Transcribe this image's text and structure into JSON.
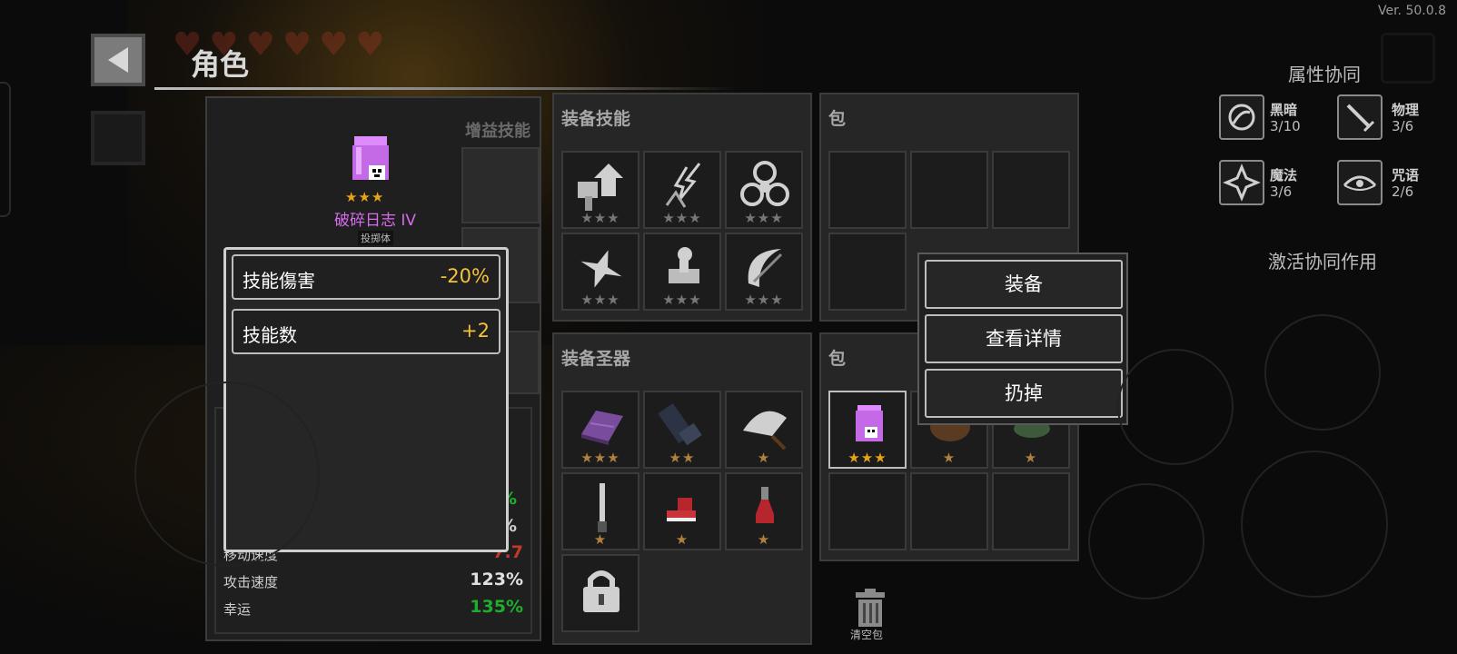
{
  "version": "Ver. 50.0.8",
  "header": {
    "title": "角色"
  },
  "character": {
    "name": "破碎日志 IV",
    "subtitle": "投掷体",
    "name_color": "#d86bf0"
  },
  "buff_skills": {
    "title": "增益技能"
  },
  "stats": [
    {
      "label": "移动速度",
      "value": "7.7",
      "color": "#c0392b"
    },
    {
      "label": "攻击速度",
      "value": "123%",
      "color": "#e0e0e0"
    },
    {
      "label": "幸运",
      "value": "135%",
      "color": "#1fae2b"
    }
  ],
  "partial_stats": [
    "%",
    "%"
  ],
  "tooltip": {
    "rows": [
      {
        "label": "技能傷害",
        "value": "-20%"
      },
      {
        "label": "技能数",
        "value": "+2"
      }
    ]
  },
  "equip_skills": {
    "title": "装备技能",
    "items": [
      {
        "icon": "hammer-arrow-icon",
        "stars": "★★★"
      },
      {
        "icon": "lightning-figure-icon",
        "stars": "★★★"
      },
      {
        "icon": "biohazard-icon",
        "stars": "★★★"
      },
      {
        "icon": "shuriken-icon",
        "stars": "★★★"
      },
      {
        "icon": "crawling-figure-icon",
        "stars": "★★★"
      },
      {
        "icon": "crescent-slash-icon",
        "stars": "★★★"
      }
    ]
  },
  "equip_relics": {
    "title": "装备圣器",
    "items": [
      {
        "icon": "purple-book-icon",
        "stars": "★★★"
      },
      {
        "icon": "dark-gauntlet-icon",
        "stars": "★★"
      },
      {
        "icon": "feather-fan-icon",
        "stars": "★"
      },
      {
        "icon": "dagger-icon",
        "stars": "★"
      },
      {
        "icon": "red-boot-icon",
        "stars": "★"
      },
      {
        "icon": "red-potion-icon",
        "stars": "★"
      },
      {
        "icon": "lock-icon",
        "stars": ""
      }
    ]
  },
  "bag_top": {
    "title": "包"
  },
  "bag_bottom": {
    "title": "包",
    "items": [
      {
        "icon": "purple-log-icon",
        "stars": "★★★"
      },
      {
        "icon": "brown-sack-icon",
        "stars": "★"
      },
      {
        "icon": "green-herb-icon",
        "stars": "★"
      }
    ]
  },
  "context_menu": {
    "equip": "装备",
    "details": "查看详情",
    "discard": "扔掉"
  },
  "synergy": {
    "title": "属性协同",
    "items": [
      {
        "icon": "dark-orb-icon",
        "name": "黑暗",
        "count": "3/10"
      },
      {
        "icon": "sword-icon",
        "name": "物理",
        "count": "3/6"
      },
      {
        "icon": "magic-star-icon",
        "name": "魔法",
        "count": "3/6"
      },
      {
        "icon": "curse-eye-icon",
        "name": "咒语",
        "count": "2/6"
      }
    ],
    "activate_label": "激活协同作用"
  },
  "clear_bag": {
    "label": "清空包"
  }
}
